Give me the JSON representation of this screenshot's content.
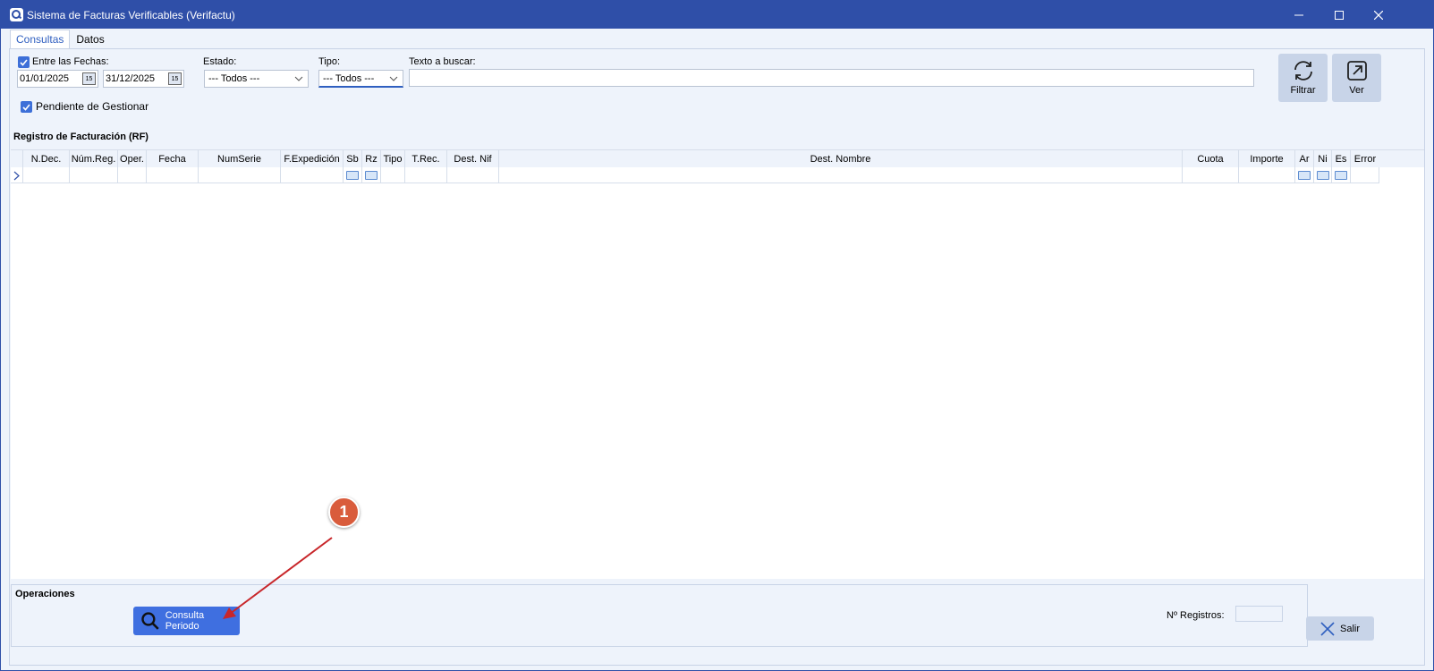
{
  "window": {
    "title": "Sistema de Facturas Verificables (Verifactu)"
  },
  "tabs": [
    {
      "label": "Consultas"
    },
    {
      "label": "Datos"
    }
  ],
  "filters": {
    "dates_checkbox_label": "Entre las Fechas:",
    "date_from": "01/01/2025",
    "date_to": "31/12/2025",
    "estado_label": "Estado:",
    "estado_value": "--- Todos ---",
    "tipo_label": "Tipo:",
    "tipo_value": "--- Todos ---",
    "texto_label": "Texto a buscar:",
    "texto_value": "",
    "pendiente_label": "Pendiente de Gestionar"
  },
  "buttons": {
    "filtrar": "Filtrar",
    "ver": "Ver",
    "consulta": "Consulta Periodo",
    "salir": "Salir"
  },
  "grid": {
    "title": "Registro de Facturación (RF)",
    "columns": [
      "N.Dec.",
      "Núm.Reg.",
      "Oper.",
      "Fecha",
      "NumSerie",
      "F.Expedición",
      "Sb",
      "Rz",
      "Tipo",
      "T.Rec.",
      "Dest. Nif",
      "Dest. Nombre",
      "Cuota",
      "Importe",
      "Ar",
      "Ni",
      "Es",
      "Error"
    ]
  },
  "operations": {
    "title": "Operaciones",
    "registros_label": "Nº Registros:",
    "registros_value": ""
  },
  "annotation": {
    "number": "1"
  },
  "colors": {
    "titlebar": "#2f4fa8",
    "accent": "#3f6fe0",
    "annotation": "#d95c3c"
  }
}
